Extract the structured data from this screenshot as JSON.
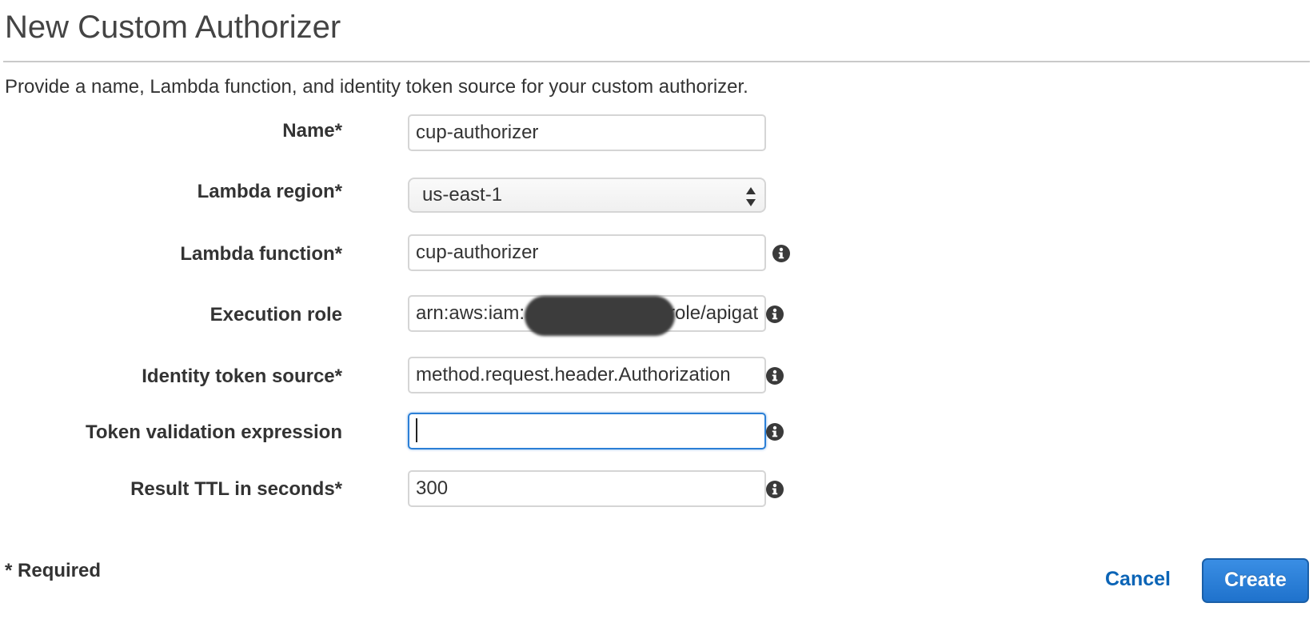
{
  "page": {
    "title": "New Custom Authorizer",
    "intro": "Provide a name, Lambda function, and identity token source for your custom authorizer."
  },
  "form": {
    "name": {
      "label": "Name*",
      "value": "cup-authorizer"
    },
    "lambda_region": {
      "label": "Lambda region*",
      "value": "us-east-1"
    },
    "lambda_function": {
      "label": "Lambda function*",
      "value": "cup-authorizer"
    },
    "execution_role": {
      "label": "Execution role",
      "value_prefix": "arn:aws:iam:",
      "value_suffix": "role/apigat"
    },
    "identity_token_source": {
      "label": "Identity token source*",
      "value": "method.request.header.Authorization"
    },
    "token_validation_expression": {
      "label": "Token validation expression",
      "value": ""
    },
    "result_ttl": {
      "label": "Result TTL in seconds*",
      "value": "300"
    }
  },
  "footer": {
    "required_note": "* Required",
    "cancel_label": "Cancel",
    "create_label": "Create"
  },
  "colors": {
    "link": "#0b64b6",
    "primary_button": "#1f72cc",
    "focus_border": "#2b7fd6"
  },
  "icons": {
    "info": "info-circle-icon",
    "select_arrows": "up-down-arrows-icon"
  }
}
